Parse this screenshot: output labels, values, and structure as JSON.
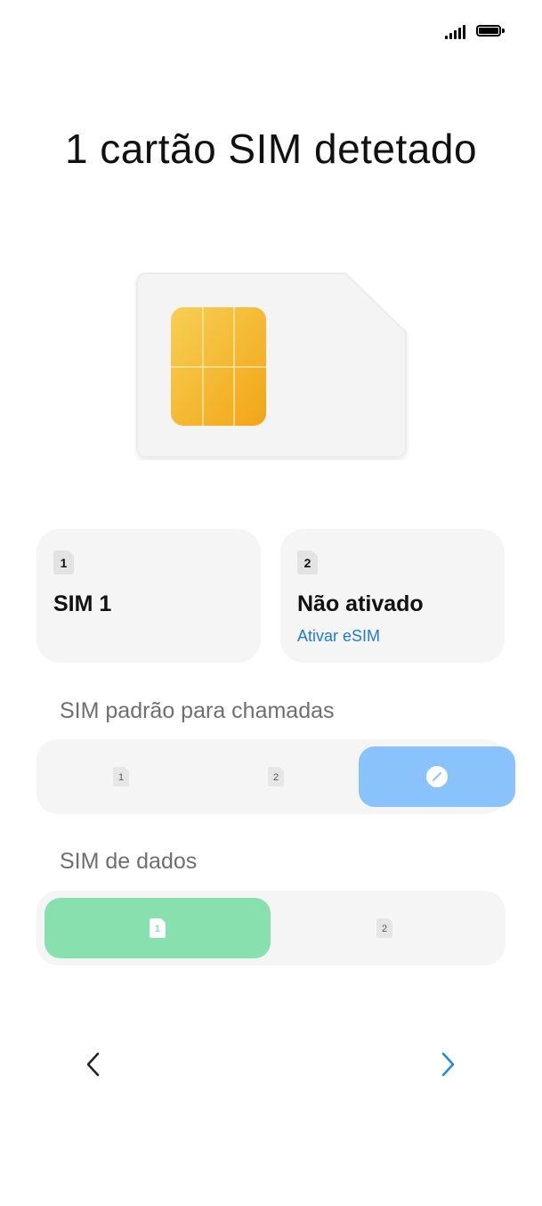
{
  "status_bar": {
    "signal_icon": "signal-bars-icon",
    "battery_icon": "battery-full-icon"
  },
  "title": "1 cartão SIM detetado",
  "illustration": {
    "icon": "sim-card-illustration"
  },
  "cards": [
    {
      "badge": "1",
      "title": "SIM 1",
      "link": ""
    },
    {
      "badge": "2",
      "title": "Não ativado",
      "link": "Ativar eSIM"
    }
  ],
  "calls": {
    "label": "SIM padrão para chamadas",
    "options": [
      "1",
      "2"
    ],
    "selected": "ask-each-time",
    "selected_color": "#8ac3fb"
  },
  "data_sim": {
    "label": "SIM de dados",
    "options": [
      "1",
      "2"
    ],
    "selected": "1",
    "selected_color": "#87e0ae"
  },
  "nav": {
    "back_icon": "chevron-left-icon",
    "next_icon": "chevron-right-icon",
    "next_color": "#1e88e5"
  },
  "link_color": "#1e7ae0"
}
